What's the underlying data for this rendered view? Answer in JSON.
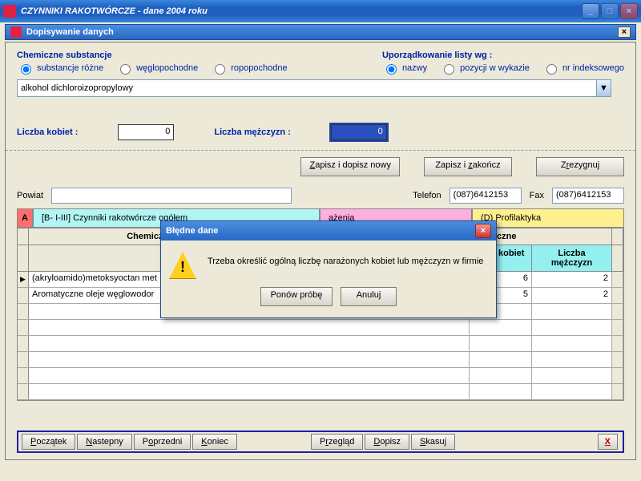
{
  "window": {
    "title": "CZYNNIKI RAKOTWÓRCZE  - dane 2004 roku"
  },
  "subwindow": {
    "title": "Dopisywanie danych"
  },
  "groups": {
    "substances_legend": "Chemiczne substancje",
    "substances_opts": {
      "a": "substancje różne",
      "b": "węglopochodne",
      "c": "ropopochodne"
    },
    "ordering_legend": "Uporządkowanie listy wg :",
    "ordering_opts": {
      "a": "nazwy",
      "b": "pozycji w wykazie",
      "c": "nr indeksowego"
    }
  },
  "dropdown": {
    "value": "alkohol dichloroizopropylowy"
  },
  "counters": {
    "women_label": "Liczba kobiet :",
    "women_val": "0",
    "men_label": "Liczba mężczyzn :",
    "men_val": "0"
  },
  "actions": {
    "save_new": "Zapisz i dopisz nowy",
    "save_close": "Zapisz i zakończ",
    "cancel": "Zrezygnuj"
  },
  "mid": {
    "powiat": "Powiat",
    "powiat_val": "",
    "telefon": "Telefon",
    "telefon_val": "(087)6412153",
    "fax": "Fax",
    "fax_val": "(087)6412153"
  },
  "tabs": {
    "A": "A",
    "B": "[B- I-III]  Czynniki rakotwórcze ogółem",
    "C": "ażenia",
    "D": "(D)  Profilaktyka"
  },
  "table": {
    "head_left": "Chemiczne substancje",
    "head_right": "Procesy technologiczne",
    "sub_women": "czba kobiet",
    "sub_men": "Liczba mężczyzn",
    "rows": [
      {
        "name": "(akryloamido)metoksyoctan met",
        "w": "6",
        "m": "2"
      },
      {
        "name": "Aromatyczne oleje węglowodor",
        "w": "5",
        "m": "2"
      }
    ]
  },
  "bottom": {
    "begin": "Początek",
    "next": "Nastepny",
    "prev": "Poprzedni",
    "end": "Koniec",
    "view": "Przegląd",
    "add": "Dopisz",
    "del": "Skasuj",
    "x": "X"
  },
  "dialog": {
    "title": "Błędne dane",
    "msg": "Trzeba określić ogólną liczbę narażonych kobiet lub mężczyzn w firmie",
    "retry": "Ponów próbę",
    "cancel": "Anuluj"
  }
}
